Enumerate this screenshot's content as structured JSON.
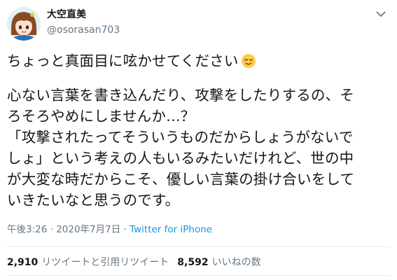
{
  "author": {
    "display_name": "大空直美",
    "handle": "@osorasan703"
  },
  "tweet": {
    "line1": "ちょっと真面目に呟かせてください",
    "emoji": "relieved-face-emoji",
    "para2_line1": "心ない言葉を書き込んだり、攻撃をしたりするの、そ",
    "para2_line2": "ろそろやめにしませんか…？",
    "para3_line1": "「攻撃されたってそういうものだからしょうがないで",
    "para3_line2": "しょ」という考えの人もいるみたいだけれど、世の中",
    "para3_line3": "が大変な時だからこそ、優しい言葉の掛け合いをして",
    "para3_line4": "いきたいなと思うのです。"
  },
  "meta": {
    "time": "午後3:26",
    "separator": " · ",
    "date": "2020年7月7日",
    "source": "Twitter for iPhone"
  },
  "stats": {
    "retweets_count": "2,910",
    "retweets_label": "リツイートと引用リツイート",
    "likes_count": "8,592",
    "likes_label": "いいねの数"
  },
  "colors": {
    "text": "#14171a",
    "secondary": "#657786",
    "link": "#1b95e0",
    "divider": "#e6ecf0"
  }
}
